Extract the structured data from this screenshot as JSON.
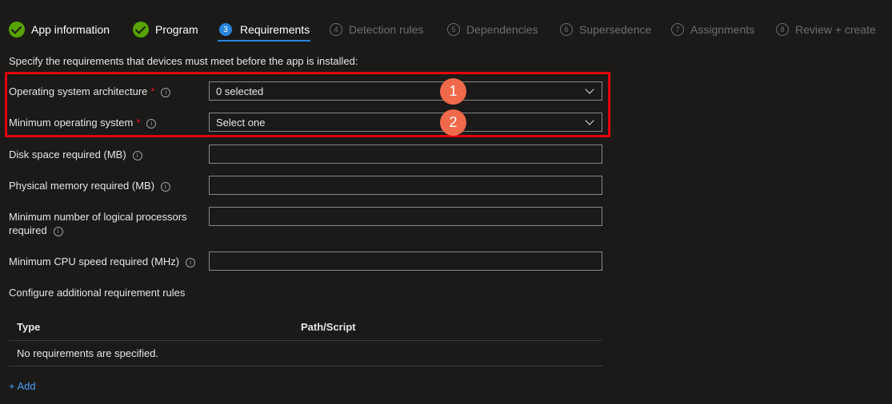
{
  "wizard": {
    "steps": [
      {
        "label": "App information",
        "state": "done"
      },
      {
        "label": "Program",
        "state": "done"
      },
      {
        "number": "3",
        "label": "Requirements",
        "state": "active"
      },
      {
        "number": "4",
        "label": "Detection rules",
        "state": "future"
      },
      {
        "number": "5",
        "label": "Dependencies",
        "state": "future"
      },
      {
        "number": "6",
        "label": "Supersedence",
        "state": "future"
      },
      {
        "number": "7",
        "label": "Assignments",
        "state": "future"
      },
      {
        "number": "8",
        "label": "Review + create",
        "state": "future"
      }
    ]
  },
  "intro": "Specify the requirements that devices must meet before the app is installed:",
  "fields": {
    "os_arch": {
      "label": "Operating system architecture",
      "required": "*",
      "value": "0 selected"
    },
    "min_os": {
      "label": "Minimum operating system",
      "required": "*",
      "value": "Select one"
    },
    "disk": {
      "label": "Disk space required (MB)",
      "value": ""
    },
    "memory": {
      "label": "Physical memory required (MB)",
      "value": ""
    },
    "processors": {
      "label_line1": "Minimum number of logical processors",
      "label_line2": "required",
      "value": ""
    },
    "cpu": {
      "label": "Minimum CPU speed required (MHz)",
      "value": ""
    }
  },
  "info_glyph": "i",
  "callouts": [
    "1",
    "2"
  ],
  "additional": {
    "title": "Configure additional requirement rules",
    "columns": [
      "Type",
      "Path/Script"
    ],
    "empty_message": "No requirements are specified.",
    "add_label": "+ Add"
  },
  "colors": {
    "accent": "#2886de",
    "success": "#57a300",
    "required": "#e81123",
    "callout_border": "#e3000b",
    "callout_badge": "#f0694a",
    "link": "#479ef5"
  }
}
